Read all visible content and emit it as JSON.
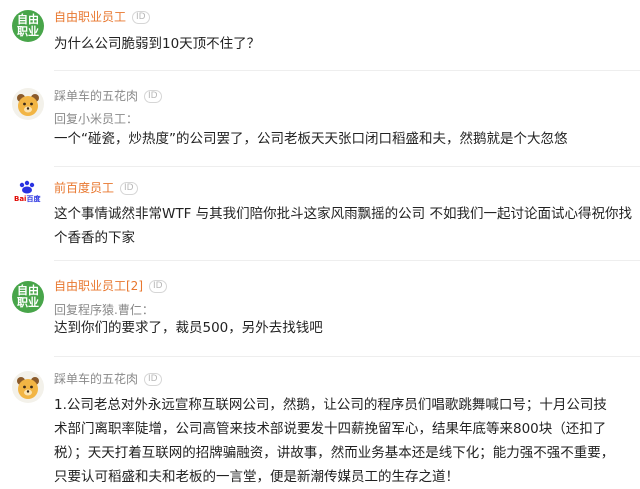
{
  "comments": [
    {
      "avatar_text": [
        "自由",
        "职业"
      ],
      "name": "自由职业员工",
      "badge": "ID",
      "reply_prefix": "",
      "reply_to": "",
      "text": "为什么公司脆弱到10天顶不住了？"
    },
    {
      "avatar_icon": "bear-icon",
      "name": "踩单车的五花肉",
      "badge": "ID",
      "reply_prefix": "回复",
      "reply_to": "小米员工：",
      "text": "一个“碰瓷，炒热度”的公司罢了，公司老板天天张口闭口稻盛和夫，然鹅就是个大忽悠"
    },
    {
      "avatar_icon": "baidu-paw-icon",
      "avatar_text": [
        "Bai",
        "百度"
      ],
      "name": "前百度员工",
      "badge": "ID",
      "reply_prefix": "",
      "reply_to": "",
      "text": "这个事情诚然非常WTF 与其我们陪你批斗这家风雨飘摇的公司 不如我们一起讨论面试心得祝你找个香香的下家"
    },
    {
      "avatar_text": [
        "自由",
        "职业"
      ],
      "name": "自由职业员工[2]",
      "badge": "ID",
      "reply_prefix": "回复",
      "reply_to": "程序猿.曹仁：",
      "text": "达到你们的要求了，裁员500，另外去找钱吧"
    },
    {
      "avatar_icon": "bear-icon",
      "name": "踩单车的五花肉",
      "badge": "ID",
      "reply_prefix": "",
      "reply_to": "",
      "text": "1.公司老总对外永远宣称互联网公司，然鹅，让公司的程序员们唱歌跳舞喊口号；十月公司技术部门离职率陡增，公司高管来技术部说要发十四薪挽留军心，结果年底等来800块（还扣了税）；天天打着互联网的招牌骗融资，讲故事，然而业务基本还是线下化；能力强不强不重要，只要认可稻盛和夫和老板的一言堂，便是新潮传媒员工的生存之道！"
    }
  ],
  "colors": {
    "orange_name": "#e8772e",
    "gray_name": "#8a8a8a",
    "green_avatar": "#48a54a",
    "baidu_blue": "#2932e1",
    "baidu_red": "#e10601"
  }
}
